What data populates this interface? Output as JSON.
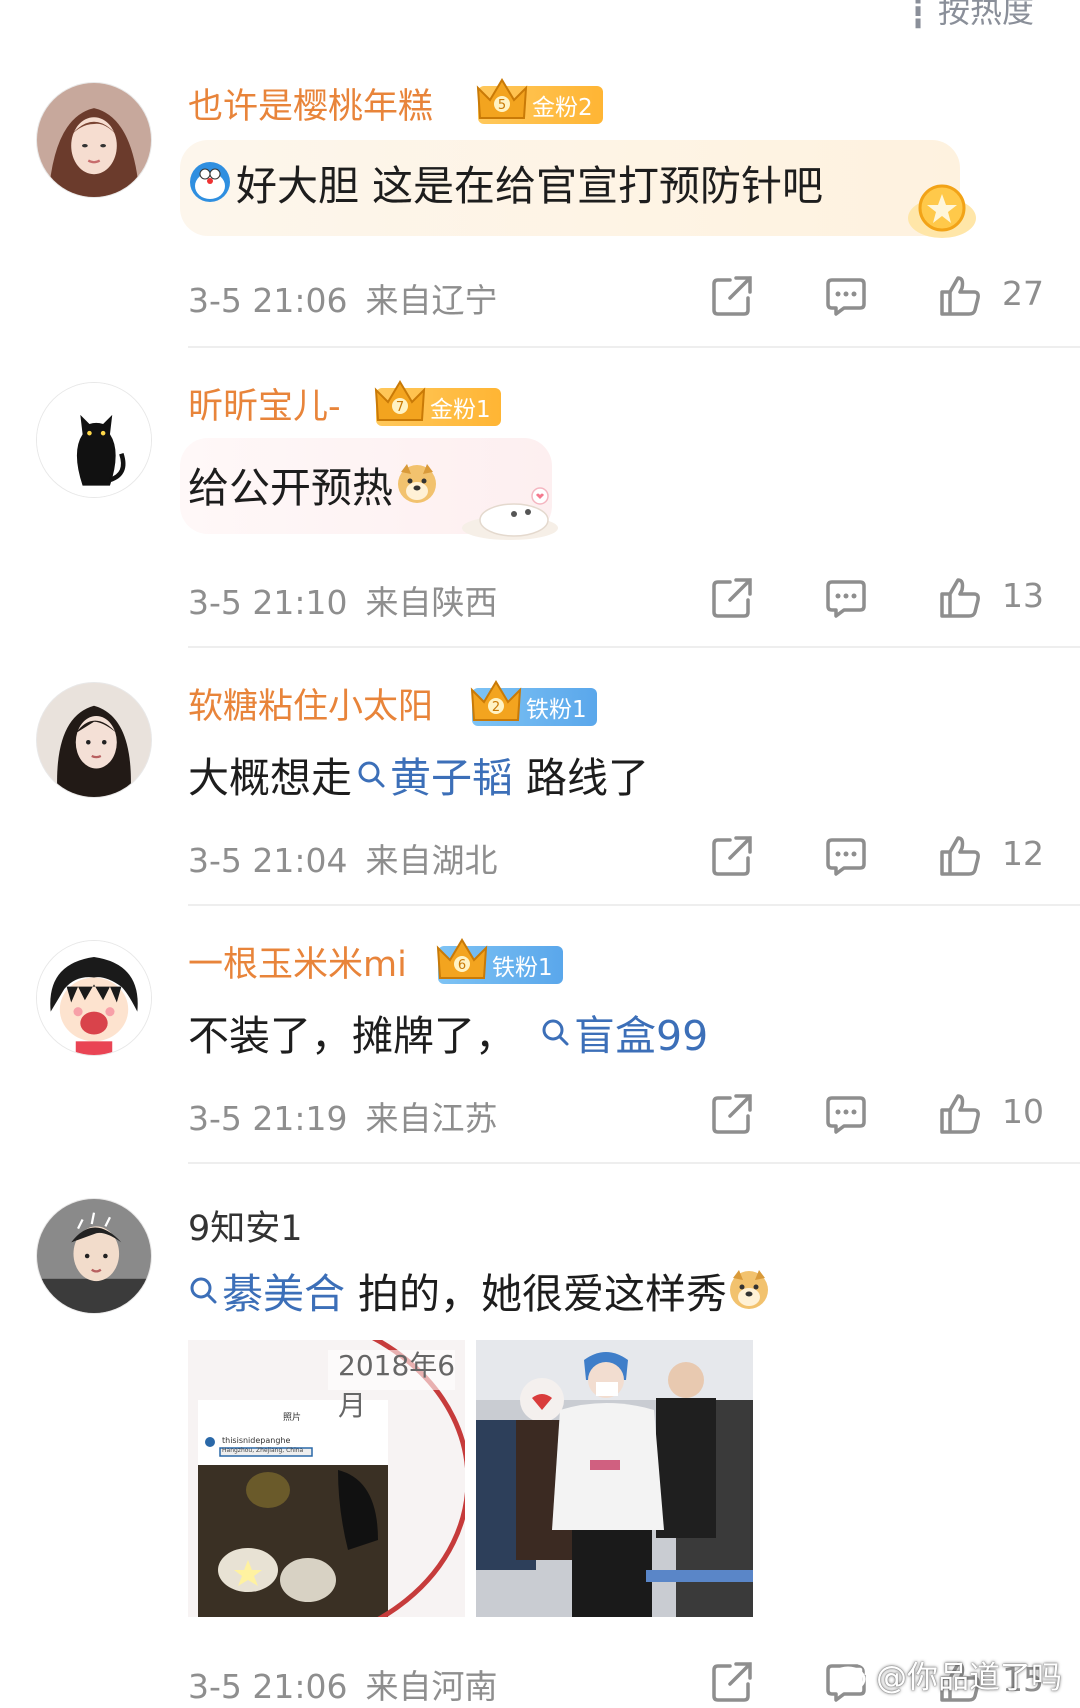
{
  "header": {
    "sort_label": "┇ 按热度"
  },
  "comments": [
    {
      "username": "也许是樱桃年糕",
      "badge": "金粉2",
      "badge_level": "5",
      "text": "好大胆 这是在给官宣打预防针吧",
      "time": "3-5 21:06",
      "location": "来自辽宁",
      "likes": "27"
    },
    {
      "username": "昕昕宝儿-",
      "badge": "金粉1",
      "badge_level": "7",
      "text": "给公开预热",
      "time": "3-5 21:10",
      "location": "来自陕西",
      "likes": "13"
    },
    {
      "username": "软糖粘住小太阳",
      "badge": "铁粉1",
      "badge_level": "2",
      "text_before": "大概想走",
      "topic": "黄子韬",
      "text_after": " 路线了",
      "time": "3-5 21:04",
      "location": "来自湖北",
      "likes": "12"
    },
    {
      "username": "一根玉米米mi",
      "badge": "铁粉1",
      "badge_level": "6",
      "text_before": "不装了，摊牌了，",
      "topic": "盲盒99",
      "time": "3-5 21:19",
      "location": "来自江苏",
      "likes": "10"
    },
    {
      "username": "9知安1",
      "topic": "綦美合",
      "text_after": " 拍的，她很爱这样秀",
      "photo_caption": "2018年6月",
      "photo_ui_title": "照片",
      "photo_ui_user": "thisisnidepanghe",
      "photo_ui_loc": "Hangzhou, Zhejiang, China",
      "time": "3-5 21:06",
      "location": "来自河南",
      "likes": "15"
    }
  ],
  "watermark": "@你品道了吗"
}
